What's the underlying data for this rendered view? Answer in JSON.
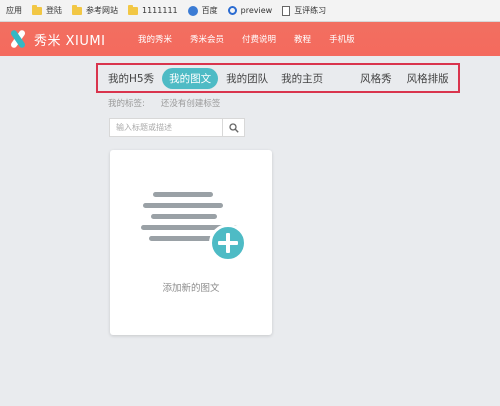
{
  "bookmarks_bar": {
    "items": [
      {
        "label": "应用",
        "icon": "apps-icon"
      },
      {
        "label": "登陆",
        "icon": "folder-icon"
      },
      {
        "label": "参考网站",
        "icon": "folder-icon"
      },
      {
        "label": "1111111",
        "icon": "folder-icon"
      },
      {
        "label": "百度",
        "icon": "baidu-paw-icon"
      },
      {
        "label": "preview",
        "icon": "ring-icon"
      },
      {
        "label": "互评练习",
        "icon": "page-icon"
      }
    ]
  },
  "header": {
    "logo_text": "秀米 XIUMI",
    "nav": [
      "我的秀米",
      "秀米会员",
      "付费说明",
      "教程",
      "手机版"
    ],
    "bg_color": "#f46a5e"
  },
  "tabs": {
    "left": [
      "我的H5秀",
      "我的图文",
      "我的团队",
      "我的主页"
    ],
    "right": [
      "风格秀",
      "风格排版"
    ],
    "active": "我的图文",
    "active_color": "#4ebbc5",
    "highlight_border": "#d9344d"
  },
  "labels": {
    "title": "我的标签:",
    "empty": "还没有创建标签"
  },
  "search": {
    "placeholder": "输入标题或描述"
  },
  "card": {
    "add_label": "添加新的图文"
  }
}
